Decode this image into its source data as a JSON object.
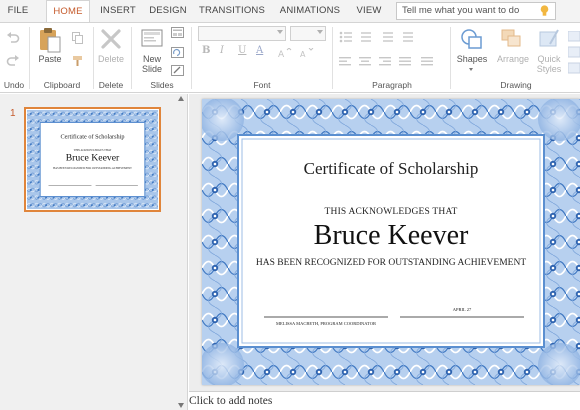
{
  "tabs": [
    {
      "label": "FILE"
    },
    {
      "label": "HOME"
    },
    {
      "label": "INSERT"
    },
    {
      "label": "DESIGN"
    },
    {
      "label": "TRANSITIONS"
    },
    {
      "label": "ANIMATIONS"
    },
    {
      "label": "VIEW"
    }
  ],
  "active_tab": "HOME",
  "tell_me": {
    "placeholder": "Tell me what you want to do"
  },
  "ribbon": {
    "undo_group": "Undo",
    "clipboard": {
      "paste": "Paste",
      "group": "Clipboard"
    },
    "delete": {
      "button": "Delete",
      "group": "Delete"
    },
    "slides": {
      "new_slide_line1": "New",
      "new_slide_line2": "Slide",
      "group": "Slides"
    },
    "font": {
      "group": "Font",
      "bold": "B",
      "italic": "I",
      "underline": "U",
      "font_color": "A"
    },
    "paragraph": {
      "group": "Paragraph"
    },
    "drawing": {
      "group": "Drawing",
      "shapes": "Shapes",
      "arrange": "Arrange",
      "quick_styles_line1": "Quick",
      "quick_styles_line2": "Styles"
    }
  },
  "slide_panel": {
    "slide_number": "1"
  },
  "certificate": {
    "title": "Certificate of Scholarship",
    "acknowledges": "THIS ACKNOWLEDGES THAT",
    "name": "Bruce Keever",
    "recognition": "HAS BEEN RECOGNIZED FOR OUTSTANDING ACHIEVEMENT",
    "signer": "MELISSA MACBETH, PROGRAM COORDINATOR",
    "date": "APRIL 27"
  },
  "notes_placeholder": "Click to add notes",
  "colors": {
    "accent": "#c55a2b",
    "border_blue": "#5b8fd0",
    "thumb_border": "#e0853b"
  }
}
